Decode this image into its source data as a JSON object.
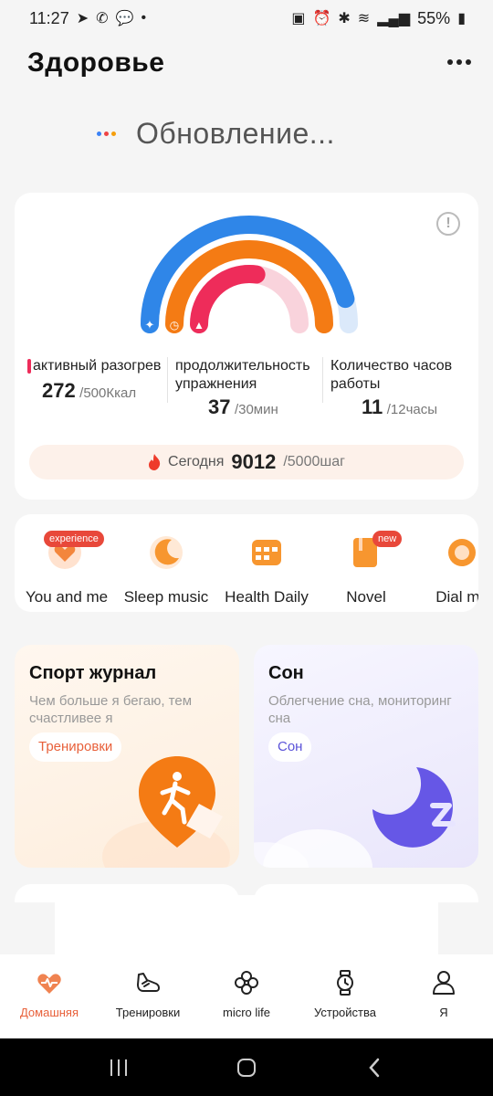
{
  "status_bar": {
    "time": "11:27",
    "battery": "55%"
  },
  "header": {
    "title": "Здоровье"
  },
  "sync": {
    "text": "Обновление..."
  },
  "activity": {
    "stats": [
      {
        "label_line1": "активный разогрев",
        "label_line2": "",
        "value": "272",
        "unit": "/500Ккал"
      },
      {
        "label_line1": "продолжительность",
        "label_line2": "упражнения",
        "value": "37",
        "unit": "/30мин"
      },
      {
        "label_line1": "Количество часов",
        "label_line2": "работы",
        "value": "11",
        "unit": "/12часы"
      }
    ],
    "rings": {
      "calories_progress": 0.544,
      "exercise_progress": 1.0,
      "stand_progress": 0.917
    },
    "today": {
      "label": "Сегодня",
      "value": "9012",
      "unit": "/5000шаг"
    }
  },
  "services": [
    {
      "label": "You and me",
      "badge": "experience"
    },
    {
      "label": "Sleep music",
      "badge": ""
    },
    {
      "label": "Health Daily",
      "badge": ""
    },
    {
      "label": "Novel",
      "badge": "new"
    },
    {
      "label": "Dial ma",
      "badge": ""
    }
  ],
  "features": {
    "sport": {
      "title": "Спорт журнал",
      "desc": "Чем больше я бегаю, тем счастливее я",
      "tag": "Тренировки"
    },
    "sleep": {
      "title": "Сон",
      "desc": "Облегчение сна, мониторинг сна",
      "tag": "Сон"
    }
  },
  "bottom_nav": [
    {
      "label": "Домашняя",
      "active": true
    },
    {
      "label": "Тренировки",
      "active": false
    },
    {
      "label": "micro life",
      "active": false
    },
    {
      "label": "Устройства",
      "active": false
    },
    {
      "label": "Я",
      "active": false
    }
  ],
  "colors": {
    "accent": "#e8603a",
    "ring_blue": "#2f86e8",
    "ring_orange": "#f47b14",
    "ring_red": "#ee2c5a"
  }
}
